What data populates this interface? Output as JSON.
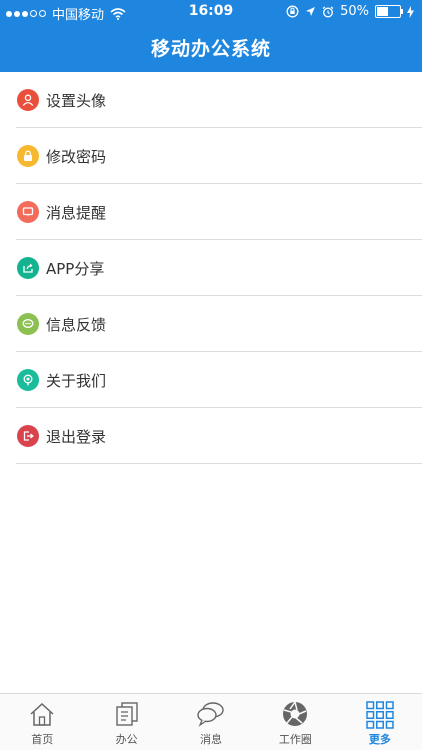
{
  "status_bar": {
    "carrier": "中国移动",
    "time": "16:09",
    "battery": "50%"
  },
  "header": {
    "title": "移动办公系统"
  },
  "menu": {
    "items": [
      {
        "label": "设置头像",
        "icon": "user-icon",
        "color": "#e94f3c"
      },
      {
        "label": "修改密码",
        "icon": "lock-icon",
        "color": "#f5b82e"
      },
      {
        "label": "消息提醒",
        "icon": "message-alert-icon",
        "color": "#f26b5b"
      },
      {
        "label": "APP分享",
        "icon": "share-icon",
        "color": "#14b38f"
      },
      {
        "label": "信息反馈",
        "icon": "feedback-icon",
        "color": "#8cc152"
      },
      {
        "label": "关于我们",
        "icon": "about-icon",
        "color": "#1abc9c"
      },
      {
        "label": "退出登录",
        "icon": "logout-icon",
        "color": "#d9434e"
      }
    ]
  },
  "tabbar": {
    "tabs": [
      {
        "label": "首页",
        "icon": "home-icon"
      },
      {
        "label": "办公",
        "icon": "office-icon"
      },
      {
        "label": "消息",
        "icon": "chat-icon"
      },
      {
        "label": "工作圈",
        "icon": "aperture-icon"
      },
      {
        "label": "更多",
        "icon": "grid-icon",
        "active": true
      }
    ],
    "active_color": "#1f86e0"
  }
}
